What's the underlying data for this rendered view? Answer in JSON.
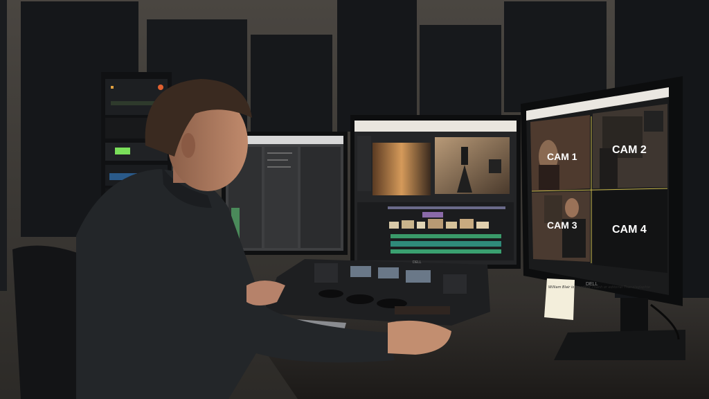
{
  "scene": {
    "description_colors": {
      "wall": "#3a3734",
      "panel": "#17191c",
      "desk": "#2b2927",
      "screen_glow": "#c9c2b4"
    }
  },
  "multicam_monitor": {
    "cameras": [
      {
        "label": "CAM 1"
      },
      {
        "label": "CAM 2"
      },
      {
        "label": "CAM 3"
      },
      {
        "label": "CAM 4"
      }
    ],
    "brand": "DELL"
  },
  "sticky_note": {
    "text": "William Blair is an editor Thanh or editorial Thanalaglaphie"
  },
  "control_surface": {
    "brand": "DELL"
  }
}
